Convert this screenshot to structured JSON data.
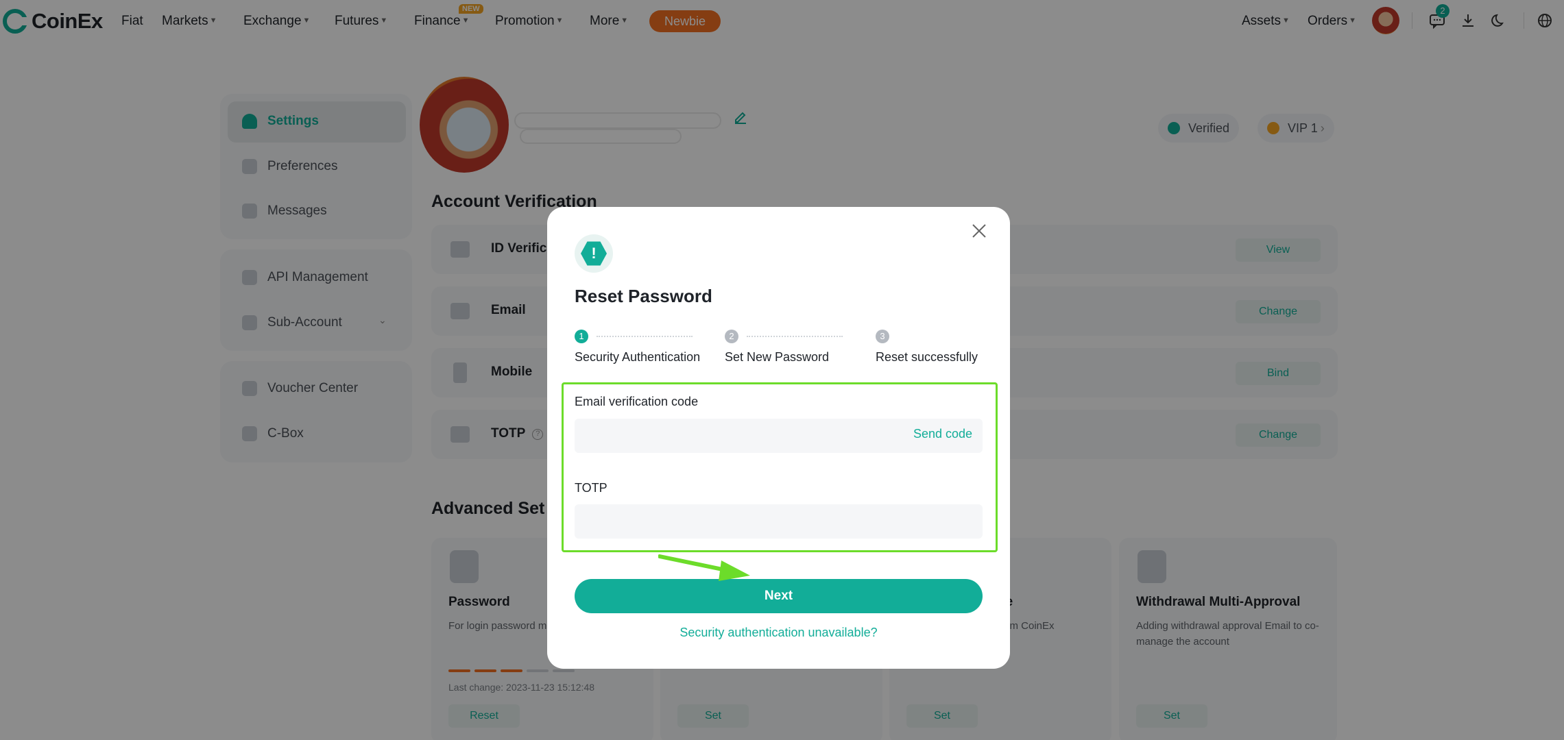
{
  "brand": {
    "name": "CoinEx",
    "accent": "#12ad98"
  },
  "topnav": {
    "items": [
      {
        "label": "Fiat",
        "dropdown": false
      },
      {
        "label": "Markets",
        "dropdown": true
      },
      {
        "label": "Exchange",
        "dropdown": true
      },
      {
        "label": "Futures",
        "dropdown": true
      },
      {
        "label": "Finance",
        "dropdown": true
      },
      {
        "label": "Promotion",
        "dropdown": true
      },
      {
        "label": "More",
        "dropdown": true
      }
    ],
    "finance_badge": "NEW",
    "newbie": "Newbie",
    "assets": "Assets",
    "orders": "Orders",
    "message_count": "2",
    "icons": [
      "avatar",
      "message-icon",
      "download-icon",
      "moon-icon",
      "globe-icon"
    ]
  },
  "sidebar": {
    "items": [
      {
        "label": "Settings",
        "icon": "user-settings-icon",
        "active": true
      },
      {
        "label": "Preferences",
        "icon": "preferences-icon"
      },
      {
        "label": "Messages",
        "icon": "messages-icon"
      },
      {
        "label": "API Management",
        "icon": "api-icon"
      },
      {
        "label": "Sub-Account",
        "icon": "sub-account-icon",
        "expandable": true
      },
      {
        "label": "Voucher Center",
        "icon": "voucher-icon"
      },
      {
        "label": "C-Box",
        "icon": "cbox-icon"
      }
    ]
  },
  "profile": {
    "verified": "Verified",
    "vip": "VIP 1"
  },
  "account_verification": {
    "title": "Account Verification",
    "rows": [
      {
        "label": "ID Verifica",
        "action": "View",
        "icon": "id-icon"
      },
      {
        "label": "Email",
        "action": "Change",
        "icon": "email-icon"
      },
      {
        "label": "Mobile",
        "action": "Bind",
        "icon": "mobile-icon"
      },
      {
        "label": "TOTP",
        "action": "Change",
        "icon": "google-auth-icon",
        "help": "?"
      }
    ]
  },
  "advanced": {
    "title": "Advanced Set",
    "cards": [
      {
        "title": "Password",
        "desc": "For login password m",
        "action": "Reset",
        "last_change": "Last change: 2023-11-23 15:12:48",
        "strength": [
          1,
          1,
          1,
          0,
          0
        ]
      },
      {
        "title": "",
        "desc": "",
        "action": "Set"
      },
      {
        "title": "de",
        "desc": "from CoinEx",
        "action": "Set"
      },
      {
        "title": "Withdrawal Multi-Approval",
        "desc": "Adding withdrawal approval Email to co-manage the account",
        "action": "Set"
      }
    ]
  },
  "modal": {
    "title": "Reset Password",
    "steps": [
      {
        "num": "1",
        "label": "Security Authentication",
        "active": true
      },
      {
        "num": "2",
        "label": "Set New Password",
        "active": false
      },
      {
        "num": "3",
        "label": "Reset successfully",
        "active": false
      }
    ],
    "email_label": "Email verification code",
    "email_value": "",
    "send_code": "Send code",
    "totp_label": "TOTP",
    "totp_value": "",
    "next": "Next",
    "unavailable": "Security authentication unavailable?"
  },
  "annotation": {
    "highlight_color": "#6cdc2a"
  }
}
